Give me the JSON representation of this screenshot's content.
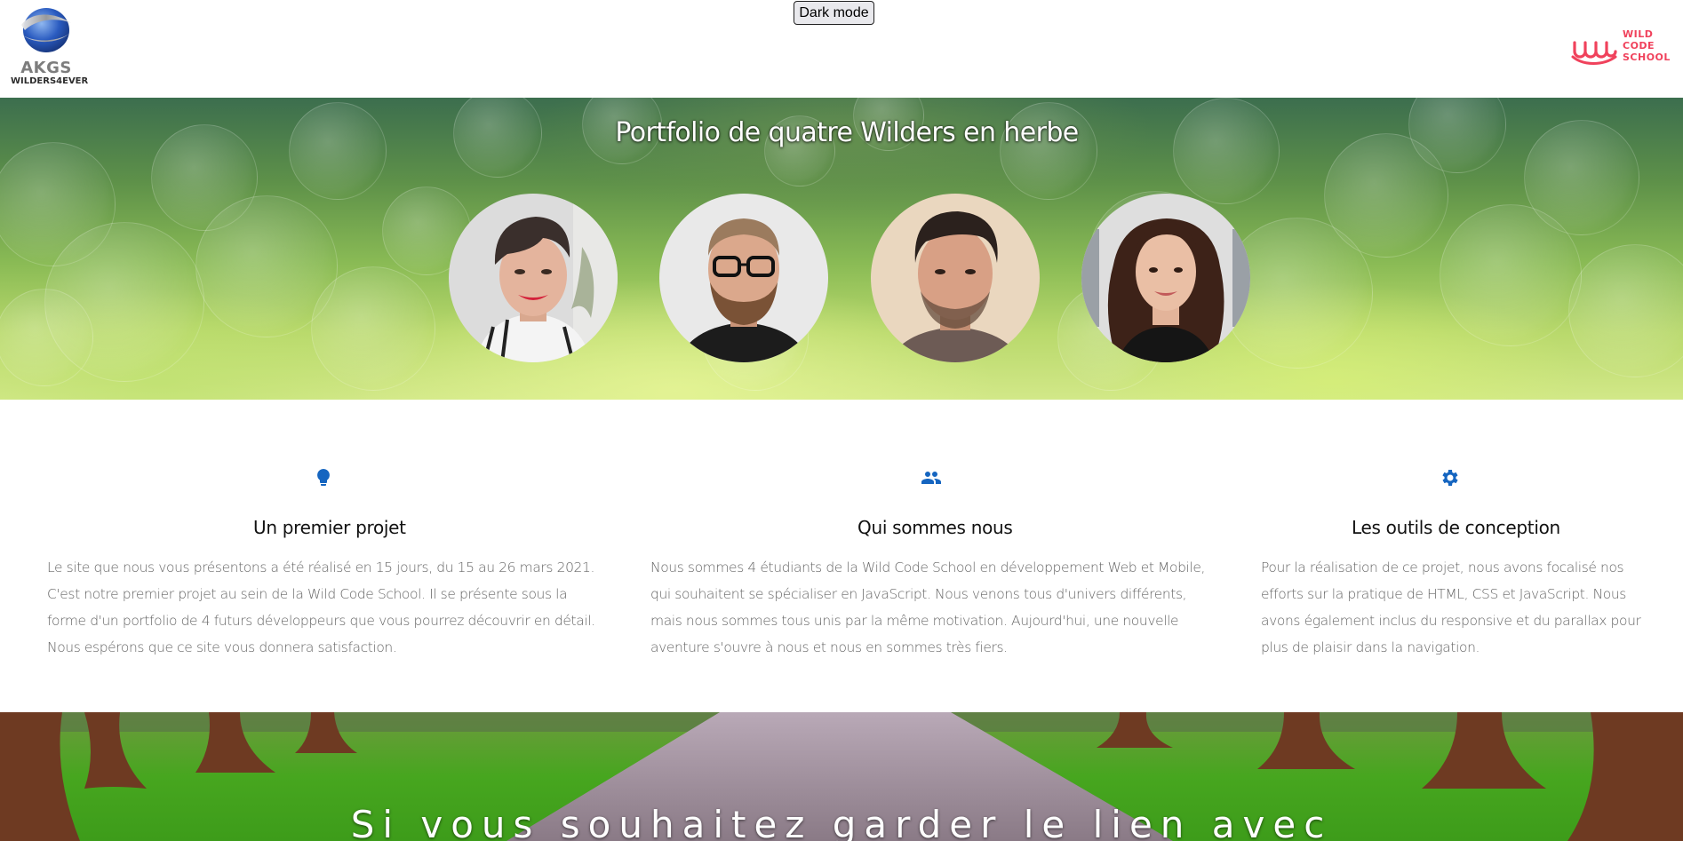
{
  "header": {
    "logo_left": {
      "brand": "AKGS",
      "tagline": "WILDERS4EVER"
    },
    "dark_mode_button": "Dark mode",
    "logo_right": {
      "line1": "WILD",
      "line2": "CODE",
      "line3": "SCHOOL"
    }
  },
  "hero": {
    "title": "Portfolio de quatre Wilders en herbe",
    "avatars": [
      {
        "label": "wilder-1"
      },
      {
        "label": "wilder-2"
      },
      {
        "label": "wilder-3"
      },
      {
        "label": "wilder-4"
      }
    ]
  },
  "features": [
    {
      "icon": "lightbulb-icon",
      "title": "Un premier projet",
      "text": "Le site que nous vous présentons a été réalisé en 15 jours, du 15 au 26 mars 2021. C'est notre premier projet au sein de la Wild Code School. Il se présente sous la forme d'un portfolio de 4 futurs développeurs que vous pourrez découvrir en détail. Nous espérons que ce site vous donnera satisfaction."
    },
    {
      "icon": "people-icon",
      "title": "Qui sommes nous",
      "text": "Nous sommes 4 étudiants de la Wild Code School en développement Web et Mobile, qui souhaitent se spécialiser en JavaScript. Nous venons tous d'univers différents, mais nous sommes tous unis par la même motivation. Aujourd'hui, une nouvelle aventure s'ouvre à nous et nous en sommes très fiers."
    },
    {
      "icon": "gear-icon",
      "title": "Les outils de conception",
      "text": "Pour la réalisation de ce projet, nous avons focalisé nos efforts sur la pratique de HTML, CSS et JavaScript. Nous avons également inclus du responsive et du parallax pour plus de plaisir dans la navigation."
    }
  ],
  "path_section": {
    "title": "Si vous souhaitez garder le lien avec"
  },
  "colors": {
    "accent_icon": "#1565c0",
    "wcs_brand": "#f0425c"
  }
}
